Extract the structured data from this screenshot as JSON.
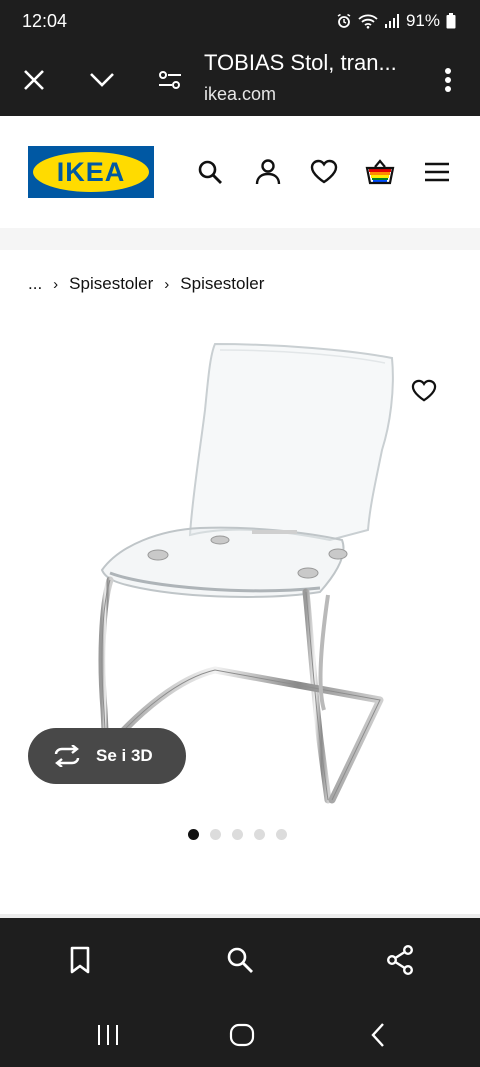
{
  "status": {
    "time": "12:04",
    "battery": "91%"
  },
  "browser": {
    "title": "TOBIAS Stol, tran...",
    "url": "ikea.com",
    "icons": [
      "close-icon",
      "chevron-down-icon",
      "page-settings-icon",
      "more-vert-icon"
    ]
  },
  "header": {
    "logo_text": "IKEA",
    "icons": [
      "search-icon",
      "user-icon",
      "heart-icon",
      "basket-icon",
      "hamburger-menu-icon"
    ]
  },
  "breadcrumb": {
    "items": [
      "...",
      "Spisestoler",
      "Spisestoler"
    ],
    "separator": "›"
  },
  "product": {
    "image_alt": "TOBIAS chair",
    "view_3d_label": "Se i 3D",
    "carousel": {
      "count": 5,
      "active": 1
    }
  },
  "toolbar": {
    "icons": [
      "bookmark-icon",
      "search-icon",
      "share-icon"
    ]
  },
  "colors": {
    "ikea_blue": "#0058a3",
    "ikea_yellow": "#ffdb00",
    "dark": "#1e1e1e"
  }
}
